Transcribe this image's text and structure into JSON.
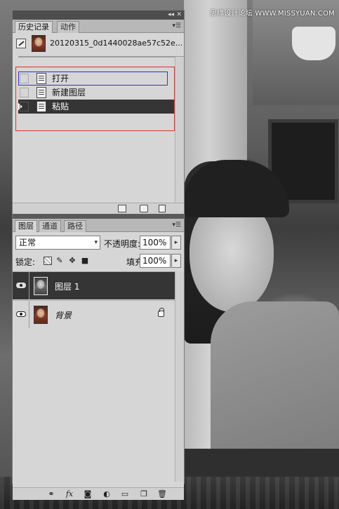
{
  "watermark": "思缘设计论坛 WWW.MISSYUAN.COM",
  "panel_top": {
    "collapse_icon": "double-chevron-left-icon",
    "close_icon": "close-icon"
  },
  "history_panel": {
    "tabs": [
      {
        "label": "历史记录",
        "active": true
      },
      {
        "label": "动作",
        "active": false
      }
    ],
    "menu_icon": "panel-menu-icon",
    "snapshot": {
      "name": "20120315_0d1440028ae57c52e..."
    },
    "steps": [
      {
        "label": "打开",
        "selected": false
      },
      {
        "label": "新建图层",
        "selected": false
      },
      {
        "label": "粘贴",
        "selected": true
      }
    ],
    "footer_icons": [
      "new-document-from-state-icon",
      "camera-snapshot-icon",
      "trash-icon"
    ]
  },
  "layers_panel": {
    "tabs": [
      {
        "label": "图层",
        "active": true
      },
      {
        "label": "通道",
        "active": false
      },
      {
        "label": "路径",
        "active": false
      }
    ],
    "blend_mode": "正常",
    "opacity_label": "不透明度:",
    "opacity_value": "100%",
    "lock_label": "锁定:",
    "fill_label": "填充:",
    "fill_value": "100%",
    "layers": [
      {
        "name": "图层 1",
        "selected": true,
        "locked": false
      },
      {
        "name": "背景",
        "selected": false,
        "locked": true
      }
    ],
    "footer_icons": [
      "link-icon",
      "fx-icon",
      "mask-icon",
      "adjustment-icon",
      "folder-icon",
      "new-layer-icon",
      "trash-icon"
    ]
  },
  "colors": {
    "selection": "#353535",
    "annotation_red": "#d13636",
    "annotation_blue": "#2b36c8"
  }
}
